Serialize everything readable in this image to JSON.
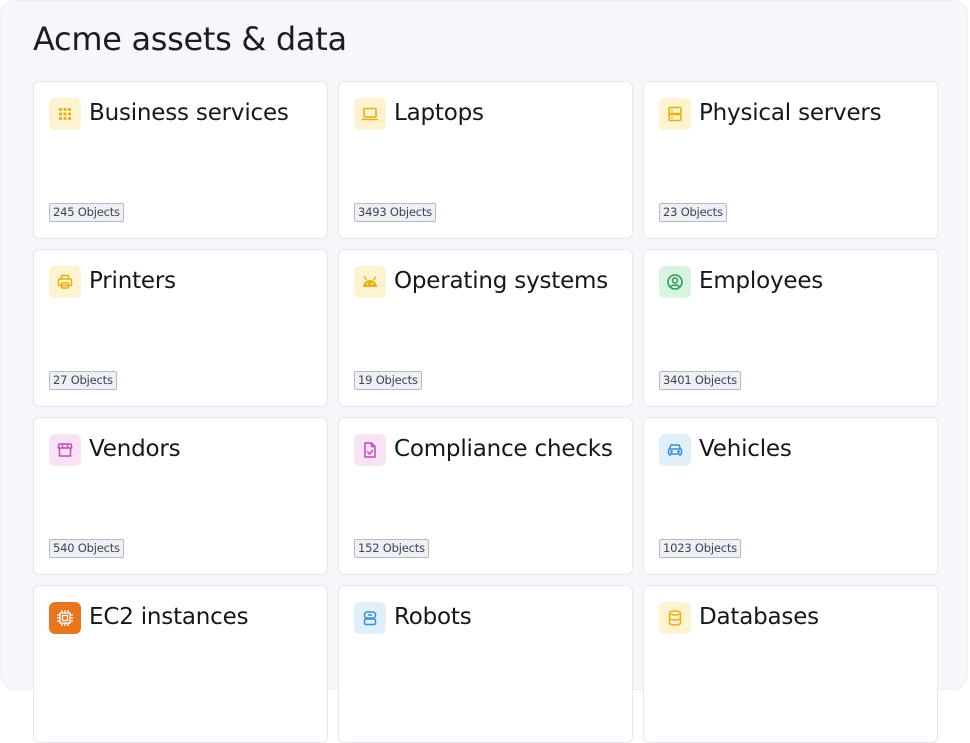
{
  "page": {
    "title": "Acme assets & data"
  },
  "cards": [
    {
      "name": "business-services",
      "title": "Business services",
      "count_label": "245 Objects",
      "icon": "grid-dots-icon",
      "icon_bg": "#fdf3d0",
      "icon_color": "#e8b10f"
    },
    {
      "name": "laptops",
      "title": "Laptops",
      "count_label": "3493 Objects",
      "icon": "laptop-icon",
      "icon_bg": "#fdf3d0",
      "icon_color": "#e8b10f"
    },
    {
      "name": "physical-servers",
      "title": "Physical servers",
      "count_label": "23 Objects",
      "icon": "server-icon",
      "icon_bg": "#fdf3d0",
      "icon_color": "#e8b10f"
    },
    {
      "name": "printers",
      "title": "Printers",
      "count_label": "27 Objects",
      "icon": "printer-icon",
      "icon_bg": "#fdf3d0",
      "icon_color": "#e8b10f"
    },
    {
      "name": "operating-systems",
      "title": "Operating systems",
      "count_label": "19 Objects",
      "icon": "android-icon",
      "icon_bg": "#fdf3d0",
      "icon_color": "#e8b10f"
    },
    {
      "name": "employees",
      "title": "Employees",
      "count_label": "3401 Objects",
      "icon": "user-circle-icon",
      "icon_bg": "#d8f3df",
      "icon_color": "#2e9a4e"
    },
    {
      "name": "vendors",
      "title": "Vendors",
      "count_label": "540 Objects",
      "icon": "store-icon",
      "icon_bg": "#f7e3f5",
      "icon_color": "#c14bbd"
    },
    {
      "name": "compliance-checks",
      "title": "Compliance checks",
      "count_label": "152 Objects",
      "icon": "file-check-icon",
      "icon_bg": "#f7e3f5",
      "icon_color": "#c14bbd"
    },
    {
      "name": "vehicles",
      "title": "Vehicles",
      "count_label": "1023 Objects",
      "icon": "car-icon",
      "icon_bg": "#e0effa",
      "icon_color": "#3a8fd3"
    },
    {
      "name": "ec2-instances",
      "title": "EC2 instances",
      "count_label": "",
      "icon": "aws-ec2-icon",
      "icon_bg": "#e8761f",
      "icon_color": "#ffffff"
    },
    {
      "name": "robots",
      "title": "Robots",
      "count_label": "",
      "icon": "robot-icon",
      "icon_bg": "#e0effa",
      "icon_color": "#3a8fd3"
    },
    {
      "name": "databases",
      "title": "Databases",
      "count_label": "",
      "icon": "database-icon",
      "icon_bg": "#fdf3d0",
      "icon_color": "#e8b10f"
    }
  ]
}
